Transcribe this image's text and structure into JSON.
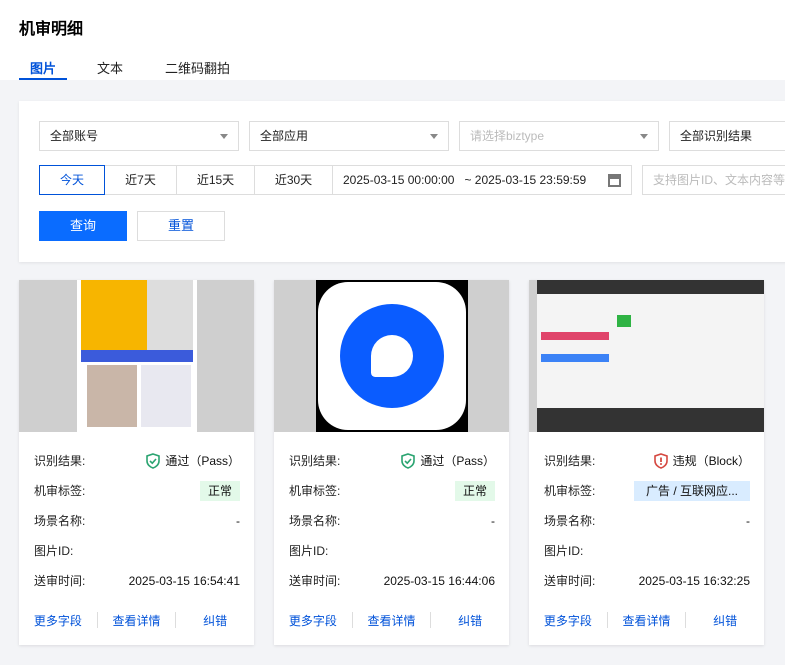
{
  "header": {
    "title": "机审明细",
    "tabs": [
      {
        "label": "图片",
        "active": true
      },
      {
        "label": "文本"
      },
      {
        "label": "二维码翻拍"
      }
    ]
  },
  "filters": {
    "account": "全部账号",
    "app": "全部应用",
    "biztype_placeholder": "请选择biztype",
    "result": "全部识别结果",
    "ranges": [
      "今天",
      "近7天",
      "近15天",
      "近30天"
    ],
    "active_range": "今天",
    "date_start": "2025-03-15 00:00:00",
    "date_end": "~ 2025-03-15 23:59:59",
    "search_placeholder": "支持图片ID、文本内容等",
    "query_label": "查询",
    "reset_label": "重置"
  },
  "labels": {
    "result": "识别结果:",
    "tag": "机审标签:",
    "scene": "场景名称:",
    "image_id": "图片ID:",
    "time": "送审时间:",
    "more": "更多字段",
    "detail": "查看详情",
    "correct": "纠错"
  },
  "cards": [
    {
      "result": "通过（Pass）",
      "status": "pass",
      "tag": "正常",
      "scene": "-",
      "image_id": "",
      "time": "2025-03-15 16:54:41"
    },
    {
      "result": "通过（Pass）",
      "status": "pass",
      "tag": "正常",
      "scene": "-",
      "image_id": "",
      "time": "2025-03-15 16:44:06"
    },
    {
      "result": "违规（Block）",
      "status": "block",
      "tag": "广告 / 互联网应...",
      "scene": "-",
      "image_id": "",
      "time": "2025-03-15 16:32:25"
    }
  ],
  "colors": {
    "primary": "#0052d9",
    "pass": "#2ba471",
    "block": "#d54941"
  }
}
